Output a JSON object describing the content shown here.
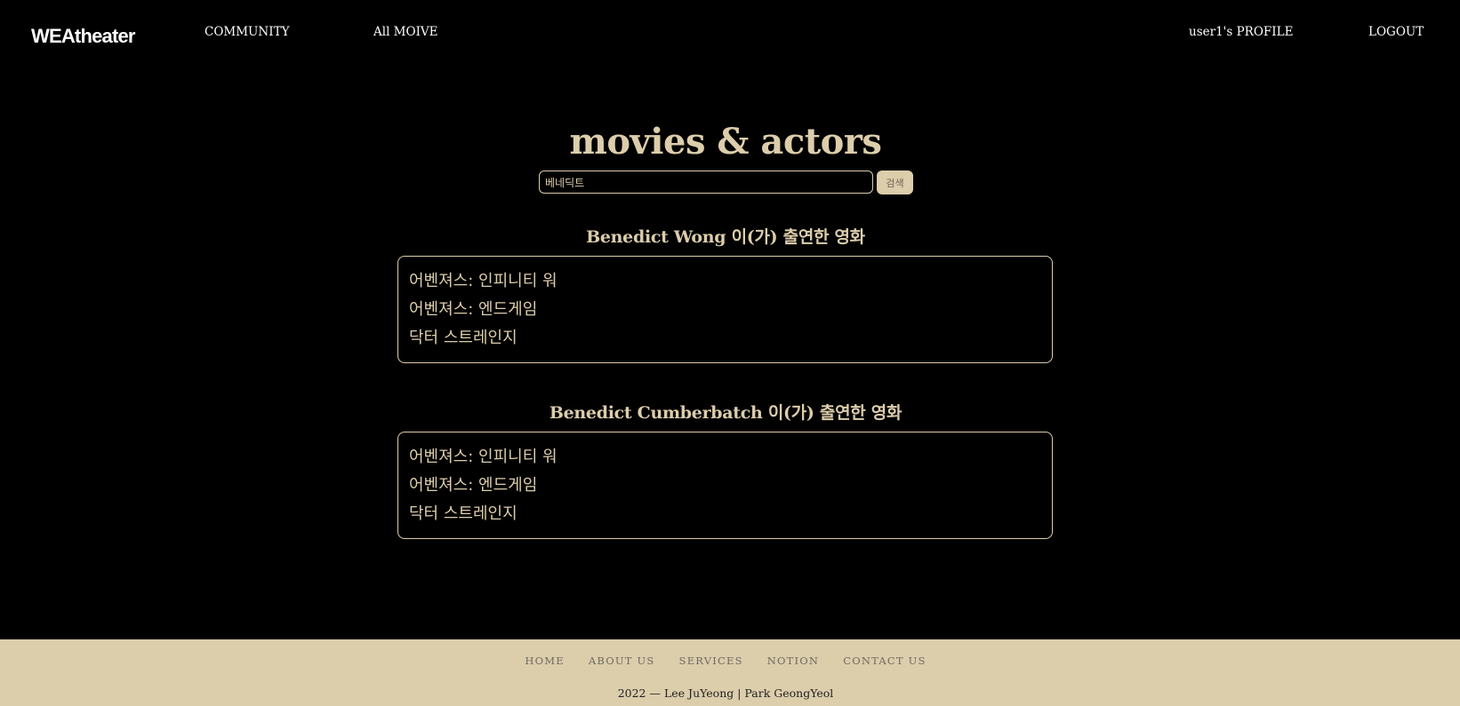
{
  "colors": {
    "background": "#000000",
    "accent": "#dccdab",
    "nav_text": "#ffffff",
    "footer_link": "#6e6a62"
  },
  "navbar": {
    "brand": "WEAtheater",
    "community": "COMMUNITY",
    "all_movie": "All MOIVE",
    "profile": "user1's PROFILE",
    "logout": "LOGOUT"
  },
  "main": {
    "title": "movies & actors",
    "search": {
      "value": "베네딕트",
      "button_label": "검색"
    },
    "results": [
      {
        "heading": "Benedict Wong 이(가) 출연한 영화",
        "movies": [
          "어벤져스: 인피니티 워",
          "어벤져스: 엔드게임",
          "닥터 스트레인지"
        ]
      },
      {
        "heading": "Benedict Cumberbatch 이(가) 출연한 영화",
        "movies": [
          "어벤져스: 인피니티 워",
          "어벤져스: 엔드게임",
          "닥터 스트레인지"
        ]
      }
    ]
  },
  "footer": {
    "links": [
      "HOME",
      "ABOUT US",
      "SERVICES",
      "NOTION",
      "CONTACT US"
    ],
    "year": "2022",
    "dash": "—",
    "authors": "Lee JuYeong | Park GeongYeol"
  }
}
